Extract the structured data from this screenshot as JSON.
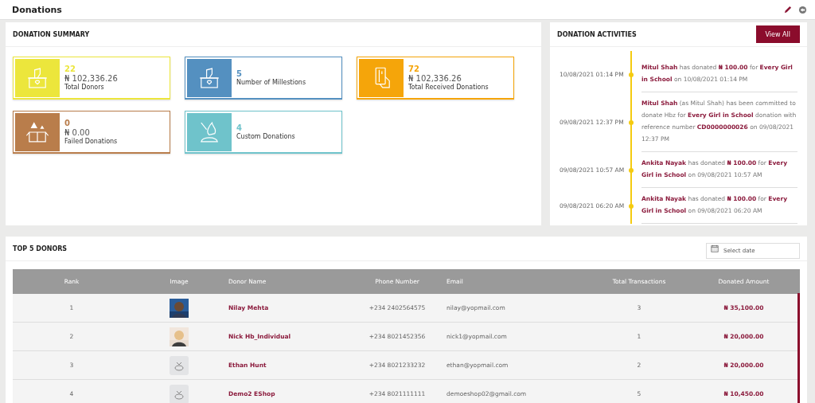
{
  "page": {
    "title": "Donations"
  },
  "summary": {
    "title": "DONATION SUMMARY",
    "cards": [
      {
        "kind": "ballot",
        "color": "#ece63c",
        "count": "22",
        "amount": "₦ 102,336.26",
        "label": "Total Donors"
      },
      {
        "kind": "ballot",
        "color": "#5490c0",
        "count": "5",
        "label": "Number of Millestions"
      },
      {
        "kind": "card",
        "color": "#f5a50a",
        "count": "72",
        "amount": "₦ 102,336.26",
        "label": "Total Received Donations"
      },
      {
        "kind": "failed",
        "color": "#b97d4b",
        "count": "0",
        "amount": "₦ 0.00",
        "label": "Failed Donations"
      },
      {
        "kind": "custom",
        "color": "#6fc3cb",
        "count": "4",
        "label": "Custom Donations"
      }
    ]
  },
  "activities": {
    "title": "DONATION ACTIVITIES",
    "button": "View All",
    "items": [
      {
        "time": "10/08/2021 01:14 PM",
        "text": "**Mitul Shah** has donated **₦ 100.00** for **Every Girl in School** on 10/08/2021 01:14 PM"
      },
      {
        "time": "09/08/2021 12:37 PM",
        "text": "**Mitul Shah** (as Mitul Shah) has been committed to donate Hbz for **Every Girl in School** donation with reference number **CD0000000026** on 09/08/2021 12:37 PM"
      },
      {
        "time": "09/08/2021 10:57 AM",
        "text": "**Ankita Nayak** has donated **₦ 100.00** for **Every Girl in School** on 09/08/2021 10:57 AM"
      },
      {
        "time": "09/08/2021 06:20 AM",
        "text": "**Ankita Nayak** has donated **₦ 100.00** for **Every Girl in School** on 09/08/2021 06:20 AM"
      }
    ]
  },
  "donors": {
    "title": "TOP 5 DONORS",
    "date_field": {
      "placeholder": "Select date"
    },
    "columns": [
      "Rank",
      "Image",
      "Donor Name",
      "Phone Number",
      "Email",
      "Total Transactions",
      "Donated Amount"
    ],
    "rows": [
      {
        "rank": "1",
        "name": "Nilay Mehta",
        "phone": "+234 2402564575",
        "email": "nilay@yopmail.com",
        "transactions": "3",
        "amount": "₦ 35,100.00"
      },
      {
        "rank": "2",
        "name": "Nick Hb_Individual",
        "phone": "+234 8021452356",
        "email": "nick1@yopmail.com",
        "transactions": "1",
        "amount": "₦ 20,000.00"
      },
      {
        "rank": "3",
        "kind": "placeholder",
        "name": "Ethan Hunt",
        "phone": "+234 8021233232",
        "email": "ethan@yopmail.com",
        "transactions": "2",
        "amount": "₦ 20,000.00"
      },
      {
        "rank": "4",
        "kind": "placeholder",
        "name": "Demo2 EShop",
        "phone": "+234 8021111111",
        "email": "demoeshop02@gmail.com",
        "transactions": "5",
        "amount": "₦ 10,450.00"
      }
    ]
  }
}
